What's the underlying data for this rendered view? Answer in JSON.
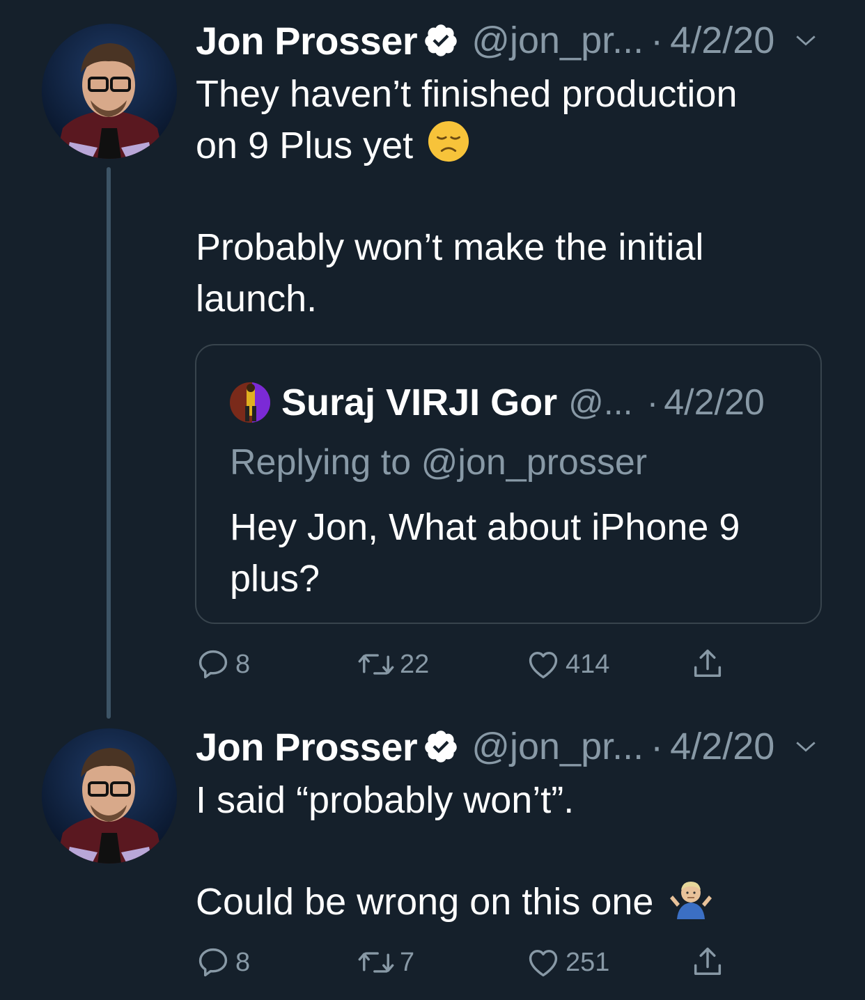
{
  "tweets": [
    {
      "author": {
        "name": "Jon Prosser",
        "handle": "@jon_pr...",
        "verified": true
      },
      "separator": "·",
      "date": "4/2/20",
      "text_lines": [
        "They haven’t finished production",
        "on 9 Plus yet",
        "Probably won’t make the initial",
        "launch."
      ],
      "emoji": "disappointed-face-icon",
      "quoted_tweet": {
        "author": {
          "name": "Suraj VIRJI Gor",
          "handle": "@..."
        },
        "separator": "·",
        "date": "4/2/20",
        "replying_to": "Replying to @jon_prosser",
        "text_lines": [
          "Hey Jon, What about iPhone 9",
          "plus?"
        ]
      },
      "actions": {
        "replies": "8",
        "retweets": "22",
        "likes": "414"
      }
    },
    {
      "author": {
        "name": "Jon Prosser",
        "handle": "@jon_pr...",
        "verified": true
      },
      "separator": "·",
      "date": "4/2/20",
      "text_lines": [
        "I said “probably won’t”.",
        "Could be wrong on this one"
      ],
      "emoji": "person-shrugging-icon",
      "actions": {
        "replies": "8",
        "retweets": "7",
        "likes": "251"
      }
    }
  ],
  "colors": {
    "background": "#15202b",
    "secondary_text": "#8899a6",
    "border": "#38444d",
    "thread_line": "#3d5466"
  }
}
